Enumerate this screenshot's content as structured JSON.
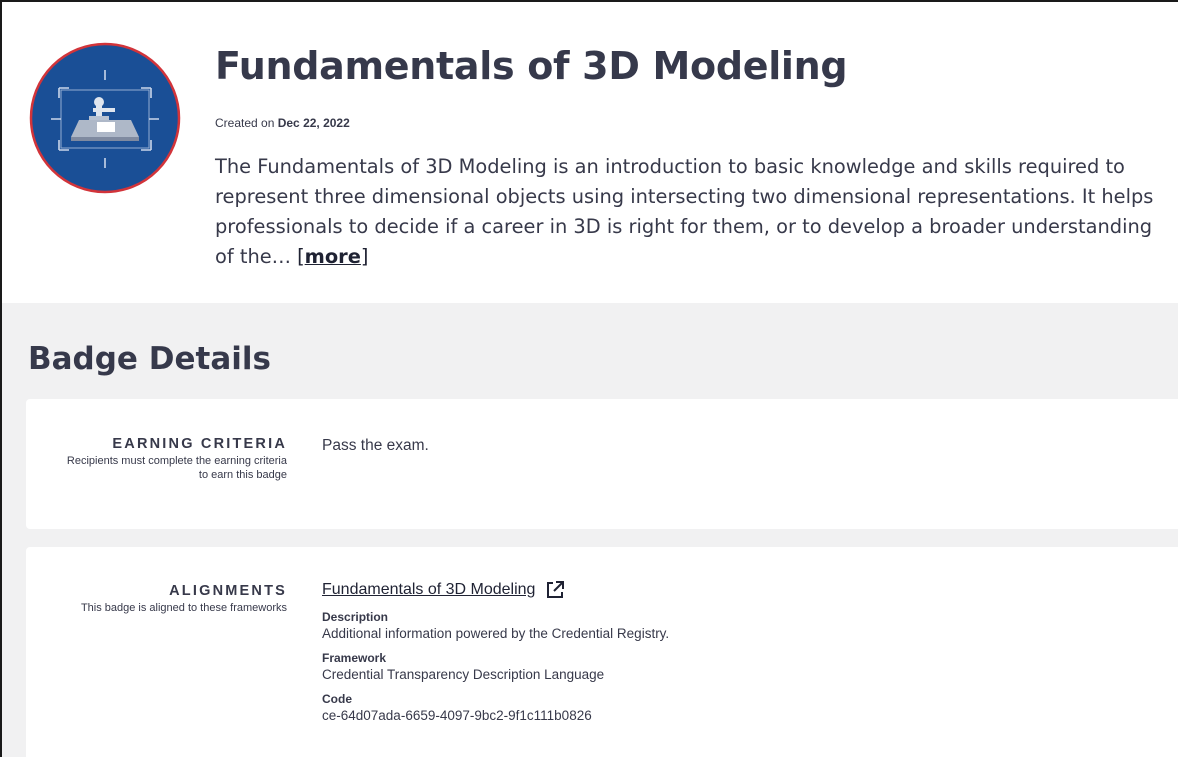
{
  "badge": {
    "title": "Fundamentals of 3D Modeling",
    "created_prefix": "Created on",
    "created_date": "Dec 22, 2022",
    "description": "The Fundamentals of 3D Modeling is an introduction to basic knowledge and skills required to represent three dimensional objects using intersecting two dimensional representations. It helps professionals to decide if a career in 3D is right for them, or to develop a broader understanding of the…",
    "more_label": "more",
    "image_icon": "3d-modeling-badge-icon",
    "colors": {
      "badge_fill": "#1a4f96",
      "badge_ring": "#d2343a"
    }
  },
  "details": {
    "title": "Badge Details",
    "earning": {
      "label": "EARNING CRITERIA",
      "help": "Recipients must complete the earning criteria to earn this badge",
      "value": "Pass the exam."
    },
    "alignments": {
      "label": "ALIGNMENTS",
      "help": "This badge is aligned to these frameworks",
      "link_text": "Fundamentals of 3D Modeling",
      "link_icon": "external-link-icon",
      "description_label": "Description",
      "description_value": "Additional information powered by the Credential Registry.",
      "framework_label": "Framework",
      "framework_value": "Credential Transparency Description Language",
      "code_label": "Code",
      "code_value": "ce-64d07ada-6659-4097-9bc2-9f1c111b0826"
    }
  }
}
